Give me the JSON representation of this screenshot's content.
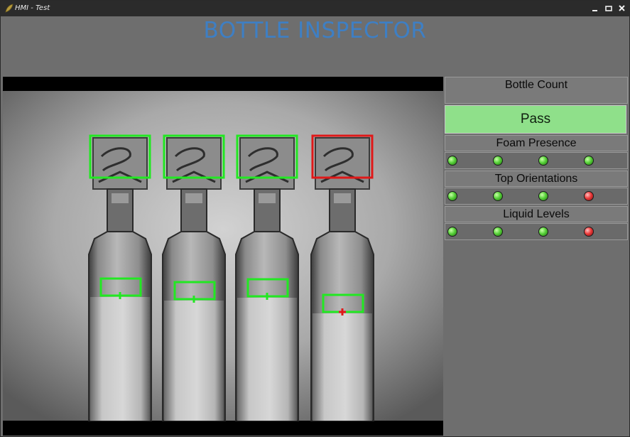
{
  "window": {
    "title": "HMI - Test",
    "minimize_label": "–",
    "maximize_label": "▭",
    "close_label": "✕",
    "icon": "app-leaf-icon"
  },
  "header": {
    "title": "BOTTLE INSPECTOR",
    "color": "#3e7fc4"
  },
  "camera": {
    "description_icon": "camera-feed",
    "bottles": [
      {
        "cap_check": "pass",
        "level_check": "pass"
      },
      {
        "cap_check": "pass",
        "level_check": "pass"
      },
      {
        "cap_check": "pass",
        "level_check": "pass"
      },
      {
        "cap_check": "fail",
        "level_check": "fail"
      }
    ],
    "pass_color": "#22e822",
    "fail_color": "#e01818"
  },
  "panel": {
    "bottle_count_label": "Bottle Count",
    "status": "Pass",
    "status_color": "#8fe08a",
    "foam_label": "Foam Presence",
    "foam_leds": [
      "green",
      "green",
      "green",
      "green"
    ],
    "orientation_label": "Top Orientations",
    "orientation_leds": [
      "green",
      "green",
      "green",
      "red"
    ],
    "liquid_label": "Liquid Levels",
    "liquid_leds": [
      "green",
      "green",
      "green",
      "red"
    ]
  }
}
